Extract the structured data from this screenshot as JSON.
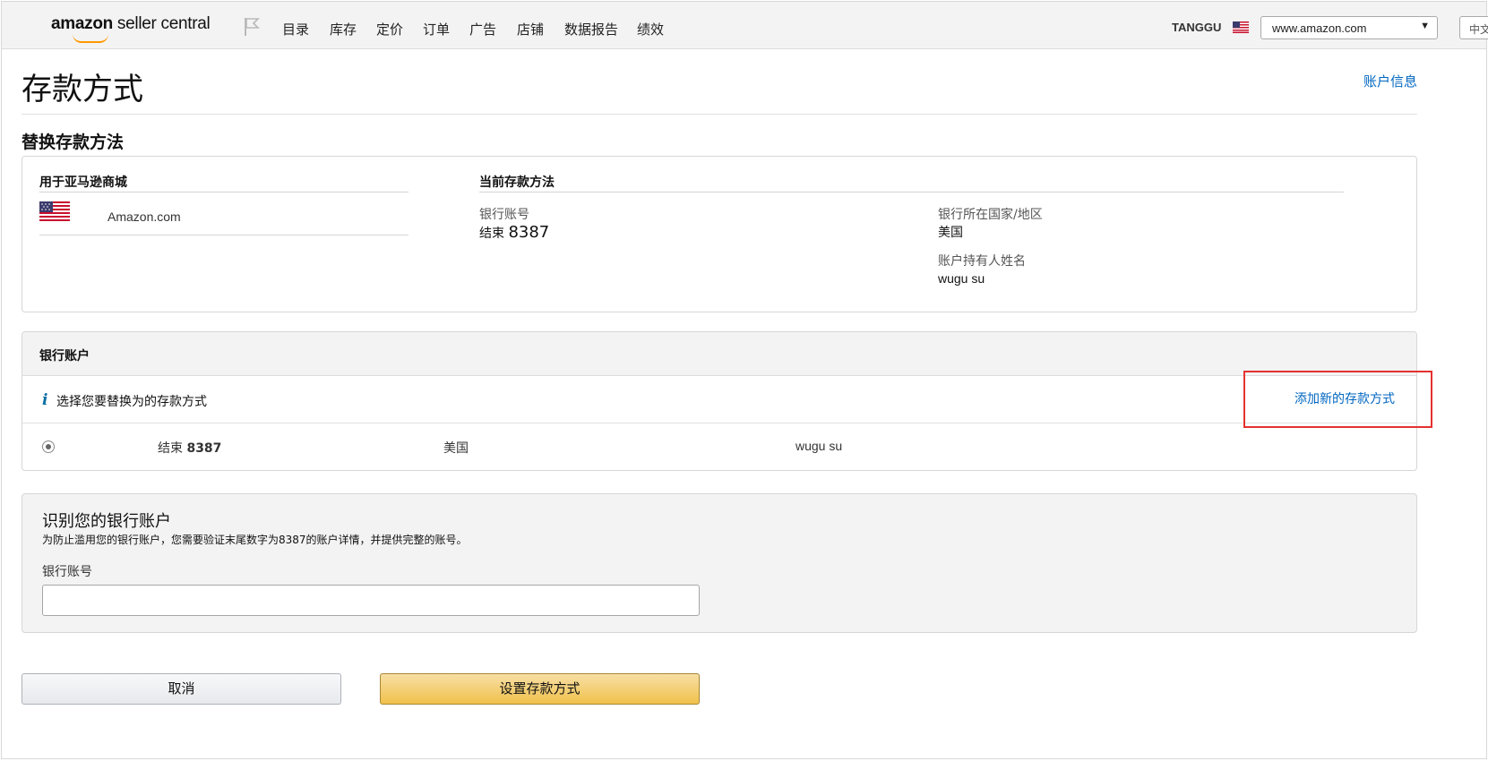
{
  "header": {
    "logo_bold": "amazon",
    "logo_rest": " seller central",
    "nav": [
      "目录",
      "库存",
      "定价",
      "订单",
      "广告",
      "店铺",
      "数据报告",
      "绩效"
    ],
    "store_name": "TANGGU",
    "marketplace": "www.amazon.com",
    "language": "中文"
  },
  "page": {
    "title": "存款方式",
    "account_info_link": "账户信息",
    "section_title": "替换存款方法"
  },
  "current": {
    "marketplace_heading": "用于亚马逊商城",
    "marketplace_name": "Amazon.com",
    "method_heading": "当前存款方法",
    "bank_account_label": "银行账号",
    "ending_prefix": "结束",
    "ending_digits": "8387",
    "bank_country_label": "银行所在国家/地区",
    "bank_country_value": "美国",
    "holder_label": "账户持有人姓名",
    "holder_value": "wugu su"
  },
  "bank_accounts": {
    "heading": "银行账户",
    "info_icon": "i",
    "info_text": "选择您要替换为的存款方式",
    "add_link": "添加新的存款方式",
    "rows": [
      {
        "ending_prefix": "结束",
        "ending_digits": "8387",
        "country": "美国",
        "holder": "wugu su",
        "selected": true
      }
    ]
  },
  "verify": {
    "title": "识别您的银行账户",
    "description": "为防止滥用您的银行账户，您需要验证末尾数字为8387的账户详情，并提供完整的账号。",
    "field_label": "银行账号",
    "field_value": ""
  },
  "buttons": {
    "cancel": "取消",
    "set": "设置存款方式"
  },
  "colors": {
    "link": "#0066c0",
    "primary_button": "#f0c14b",
    "highlight_border": "#e4312f"
  }
}
